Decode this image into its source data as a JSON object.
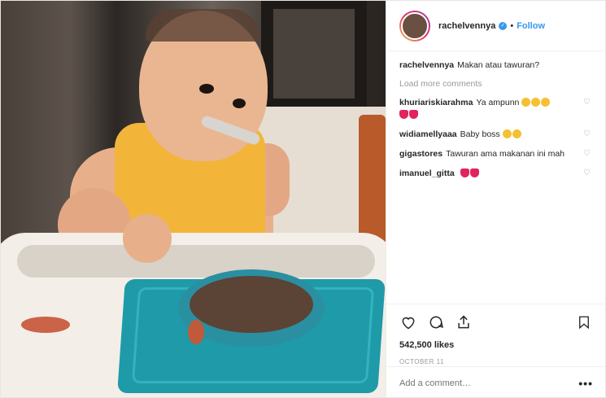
{
  "post": {
    "author": "rachelvennya",
    "follow_label": "Follow",
    "separator": "•",
    "caption": "Makan atau tawuran?"
  },
  "load_more_label": "Load more comments",
  "comments": [
    {
      "user": "khuriariskiarahma",
      "text": "Ya ampunn"
    },
    {
      "user": "widiamellyaaa",
      "text": "Baby boss"
    },
    {
      "user": "gigastores",
      "text": "Tawuran ama makanan ini mah"
    },
    {
      "user": "imanuel_gitta",
      "text": ""
    }
  ],
  "likes": "542,500 likes",
  "date": "OCTOBER 11",
  "add_comment_placeholder": "Add a comment…",
  "more_label": "•••",
  "icons": {
    "like": "heart-icon",
    "comment": "comment-bubble-icon",
    "share": "share-icon",
    "save": "bookmark-icon",
    "verified": "verified-badge-icon"
  },
  "colors": {
    "accent": "#3897f0",
    "muted": "#999999"
  }
}
